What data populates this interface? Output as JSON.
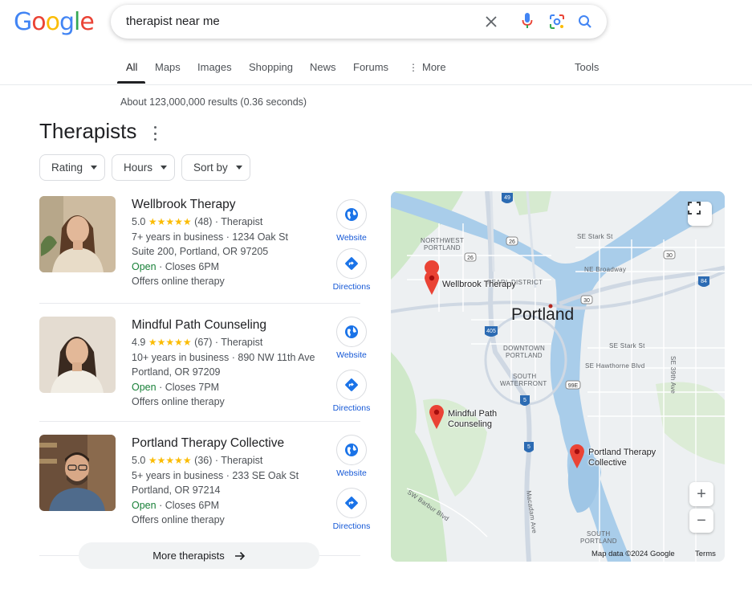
{
  "logo": {
    "letters": [
      {
        "ch": "G",
        "color": "#4285F4"
      },
      {
        "ch": "o",
        "color": "#EA4335"
      },
      {
        "ch": "o",
        "color": "#FBBC05"
      },
      {
        "ch": "g",
        "color": "#4285F4"
      },
      {
        "ch": "l",
        "color": "#34A853"
      },
      {
        "ch": "e",
        "color": "#EA4335"
      }
    ]
  },
  "search": {
    "query": "therapist near me",
    "icons": [
      "close-icon",
      "microphone-icon",
      "lens-icon",
      "search-icon"
    ]
  },
  "tabs": [
    "All",
    "Maps",
    "Images",
    "Shopping",
    "News",
    "Forums",
    "More",
    "Tools"
  ],
  "active_tab": "All",
  "stats": "About 123,000,000 results (0.36 seconds)",
  "section": {
    "title": "Therapists",
    "filters": [
      "Rating",
      "Hours",
      "Sort by"
    ]
  },
  "listings": [
    {
      "name": "Wellbrook Therapy",
      "rating": "5.0",
      "stars": "★★★★★",
      "reviews": "(48)",
      "category": "Therapist",
      "years": "7+ years in business",
      "address1": "1234 Oak St",
      "address2": "Suite 200, Portland, OR 97205",
      "open": "Open",
      "closes": "Closes 6PM",
      "online": "Offers online therapy",
      "website_label": "Website",
      "directions_label": "Directions"
    },
    {
      "name": "Mindful Path Counseling",
      "rating": "4.9",
      "stars": "★★★★★",
      "reviews": "(67)",
      "category": "Therapist",
      "years": "10+ years in business",
      "address1": "890 NW 11th Ave",
      "address2": "Portland, OR 97209",
      "open": "Open",
      "closes": "Closes 7PM",
      "online": "Offers online therapy",
      "website_label": "Website",
      "directions_label": "Directions"
    },
    {
      "name": "Portland Therapy Collective",
      "rating": "5.0",
      "stars": "★★★★★",
      "reviews": "(36)",
      "category": "Therapist",
      "years": "5+ years in business",
      "address1": "233 SE Oak St",
      "address2": "Portland, OR 97214",
      "open": "Open",
      "closes": "Closes 6PM",
      "online": "Offers online therapy",
      "website_label": "Website",
      "directions_label": "Directions"
    }
  ],
  "more_button": "More therapists",
  "map": {
    "city": "Portland",
    "areas": [
      "NORTHWEST",
      "PORTLAND",
      "PEARL DISTRICT",
      "DOWNTOWN",
      "PORTLAND",
      "SOUTH",
      "WATERFRONT",
      "SOUTH",
      "PORTLAND"
    ],
    "streets": [
      "SE Stark St",
      "NE Broadway",
      "SE Stark St",
      "SE Hawthorne Blvd",
      "SE 39th Ave",
      "SW Barbur Blvd",
      "Macadam Ave"
    ],
    "shields": [
      "405",
      "5",
      "5",
      "84",
      "26",
      "26",
      "30",
      "99E",
      "30",
      "49"
    ],
    "pins": [
      "Wellbrook Therapy",
      "Mindful Path Counseling",
      "Portland Therapy Collective"
    ],
    "pin_label_2a": "Mindful Path",
    "pin_label_2b": "Counseling",
    "pin_label_3a": "Portland Therapy",
    "pin_label_3b": "Collective",
    "zoom_in": "+",
    "zoom_out": "−",
    "attribution": "Map data ©2024 Google",
    "terms": "Terms"
  }
}
